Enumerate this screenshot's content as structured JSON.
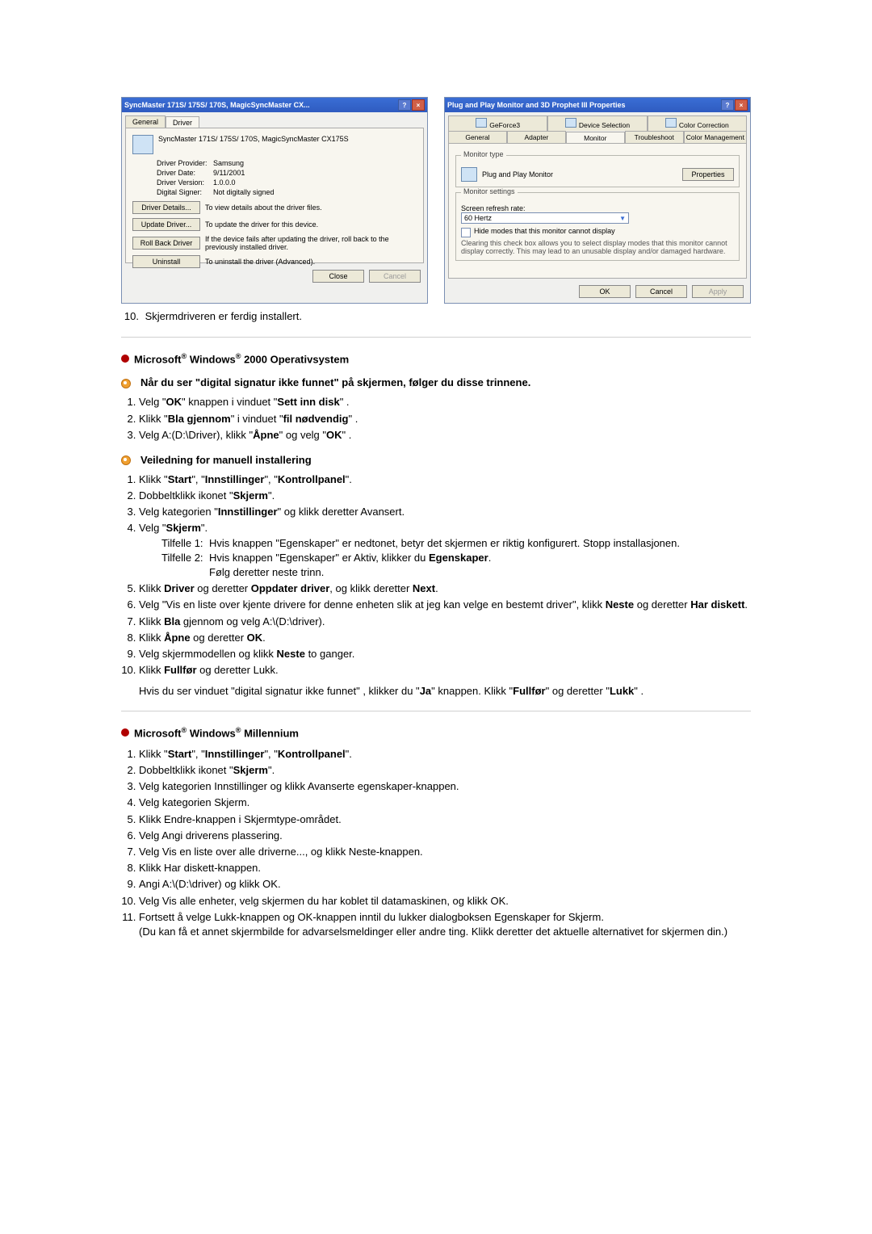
{
  "dialog1": {
    "title": "SyncMaster 171S/ 175S/ 170S, MagicSyncMaster CX...",
    "tabs": {
      "general": "General",
      "driver": "Driver"
    },
    "device_name": "SyncMaster 171S/ 175S/ 170S, MagicSyncMaster CX175S",
    "rows": {
      "provider_k": "Driver Provider:",
      "provider_v": "Samsung",
      "date_k": "Driver Date:",
      "date_v": "9/11/2001",
      "version_k": "Driver Version:",
      "version_v": "1.0.0.0",
      "signer_k": "Digital Signer:",
      "signer_v": "Not digitally signed"
    },
    "btns": {
      "details": "Driver Details...",
      "details_desc": "To view details about the driver files.",
      "update": "Update Driver...",
      "update_desc": "To update the driver for this device.",
      "rollback": "Roll Back Driver",
      "rollback_desc": "If the device fails after updating the driver, roll back to the previously installed driver.",
      "uninstall": "Uninstall",
      "uninstall_desc": "To uninstall the driver (Advanced)."
    },
    "close": "Close",
    "cancel": "Cancel"
  },
  "dialog2": {
    "title": "Plug and Play Monitor and 3D Prophet III Properties",
    "tabs_top": {
      "gf": "GeForce3",
      "dev": "Device Selection",
      "cc": "Color Correction"
    },
    "tabs_bot": {
      "gen": "General",
      "adp": "Adapter",
      "mon": "Monitor",
      "tro": "Troubleshoot",
      "cm": "Color Management"
    },
    "group_type": "Monitor type",
    "monitor_name": "Plug and Play Monitor",
    "properties": "Properties",
    "group_settings": "Monitor settings",
    "refresh_label": "Screen refresh rate:",
    "refresh_value": "60 Hertz",
    "hide_label": "Hide modes that this monitor cannot display",
    "hide_note": "Clearing this check box allows you to select display modes that this monitor cannot display correctly. This may lead to an unusable display and/or damaged hardware.",
    "ok": "OK",
    "cancel": "Cancel",
    "apply": "Apply"
  },
  "step10": "Skjermdriveren er ferdig installert.",
  "win2000": {
    "title_pre": "Microsoft",
    "title_mid": " Windows",
    "title_suf": " 2000 Operativsystem",
    "sig_title": "Når du ser \"digital signatur ikke funnet\" på skjermen, følger du disse trinnene.",
    "s1": {
      "a": "Velg \"",
      "b": "OK",
      "c": "\" knappen i vinduet \"",
      "d": "Sett inn disk",
      "e": "\" ."
    },
    "s2": {
      "a": "Klikk \"",
      "b": "Bla gjennom",
      "c": "\" i vinduet \"",
      "d": "fil nødvendig",
      "e": "\" ."
    },
    "s3": {
      "a": "Velg A:(D:\\Driver), klikk \"",
      "b": "Åpne",
      "c": "\" og velg \"",
      "d": "OK",
      "e": "\" ."
    },
    "man_title": "Veiledning for manuell installering",
    "m1": {
      "a": "Klikk \"",
      "b": "Start",
      "c": "\", \"",
      "d": "Innstillinger",
      "e": "\", \"",
      "f": "Kontrollpanel",
      "g": "\"."
    },
    "m2": {
      "a": "Dobbeltklikk ikonet \"",
      "b": "Skjerm",
      "c": "\"."
    },
    "m3": {
      "a": "Velg kategorien \"",
      "b": "Innstillinger",
      "c": "\" og klikk deretter Avansert."
    },
    "m4": {
      "a": "Velg \"",
      "b": "Skjerm",
      "c": "\"."
    },
    "case1_label": "Tilfelle 1:",
    "case1_a": "Hvis knappen \"Egenskaper\" er nedtonet, betyr det skjermen er riktig konfigurert. Stopp installasjonen.",
    "case2_label": "Tilfelle 2:",
    "case2_a": "Hvis knappen \"Egenskaper\" er Aktiv, klikker du ",
    "case2_b": "Egenskaper",
    "case2_c": ".",
    "case2_d": "Følg deretter neste trinn.",
    "m5": {
      "a": "Klikk ",
      "b": "Driver",
      "c": " og deretter ",
      "d": "Oppdater driver",
      "e": ", og klikk deretter ",
      "f": "Next",
      "g": "."
    },
    "m6": {
      "a": "Velg \"Vis en liste over kjente drivere for denne enheten slik at jeg kan velge en bestemt driver\", klikk ",
      "b": "Neste",
      "c": " og deretter ",
      "d": "Har diskett",
      "e": "."
    },
    "m7": {
      "a": "Klikk ",
      "b": "Bla",
      "c": " gjennom og velg A:\\(D:\\driver)."
    },
    "m8": {
      "a": "Klikk ",
      "b": "Åpne",
      "c": " og deretter ",
      "d": "OK",
      "e": "."
    },
    "m9": {
      "a": "Velg skjermmodellen og klikk ",
      "b": "Neste",
      "c": " to ganger."
    },
    "m10": {
      "a": "Klikk ",
      "b": "Fullfør",
      "c": " og deretter Lukk."
    },
    "note_a": "Hvis du ser vinduet \"digital signatur ikke funnet\" , klikker du \"",
    "note_b": "Ja",
    "note_c": "\" knappen. Klikk \"",
    "note_d": "Fullfør",
    "note_e": "\" og deretter \"",
    "note_f": "Lukk",
    "note_g": "\" ."
  },
  "winme": {
    "title_pre": "Microsoft",
    "title_mid": " Windows",
    "title_suf": " Millennium",
    "m1": {
      "a": "Klikk \"",
      "b": "Start",
      "c": "\", \"",
      "d": "Innstillinger",
      "e": "\", \"",
      "f": "Kontrollpanel",
      "g": "\"."
    },
    "m2": {
      "a": "Dobbeltklikk ikonet \"",
      "b": "Skjerm",
      "c": "\"."
    },
    "m3": "Velg kategorien Innstillinger og klikk Avanserte egenskaper-knappen.",
    "m4": "Velg kategorien Skjerm.",
    "m5": "Klikk Endre-knappen i Skjermtype-området.",
    "m6": "Velg Angi driverens plassering.",
    "m7": "Velg Vis en liste over alle driverne..., og klikk Neste-knappen.",
    "m8": "Klikk Har diskett-knappen.",
    "m9": "Angi A:\\(D:\\driver) og klikk OK.",
    "m10": "Velg Vis alle enheter, velg skjermen du har koblet til datamaskinen, og klikk OK.",
    "m11": "Fortsett å velge Lukk-knappen og OK-knappen inntil du lukker dialogboksen Egenskaper for Skjerm.",
    "m11_note": "(Du kan få et annet skjermbilde for advarselsmeldinger eller andre ting. Klikk deretter det aktuelle alternativet for skjermen din.)"
  }
}
